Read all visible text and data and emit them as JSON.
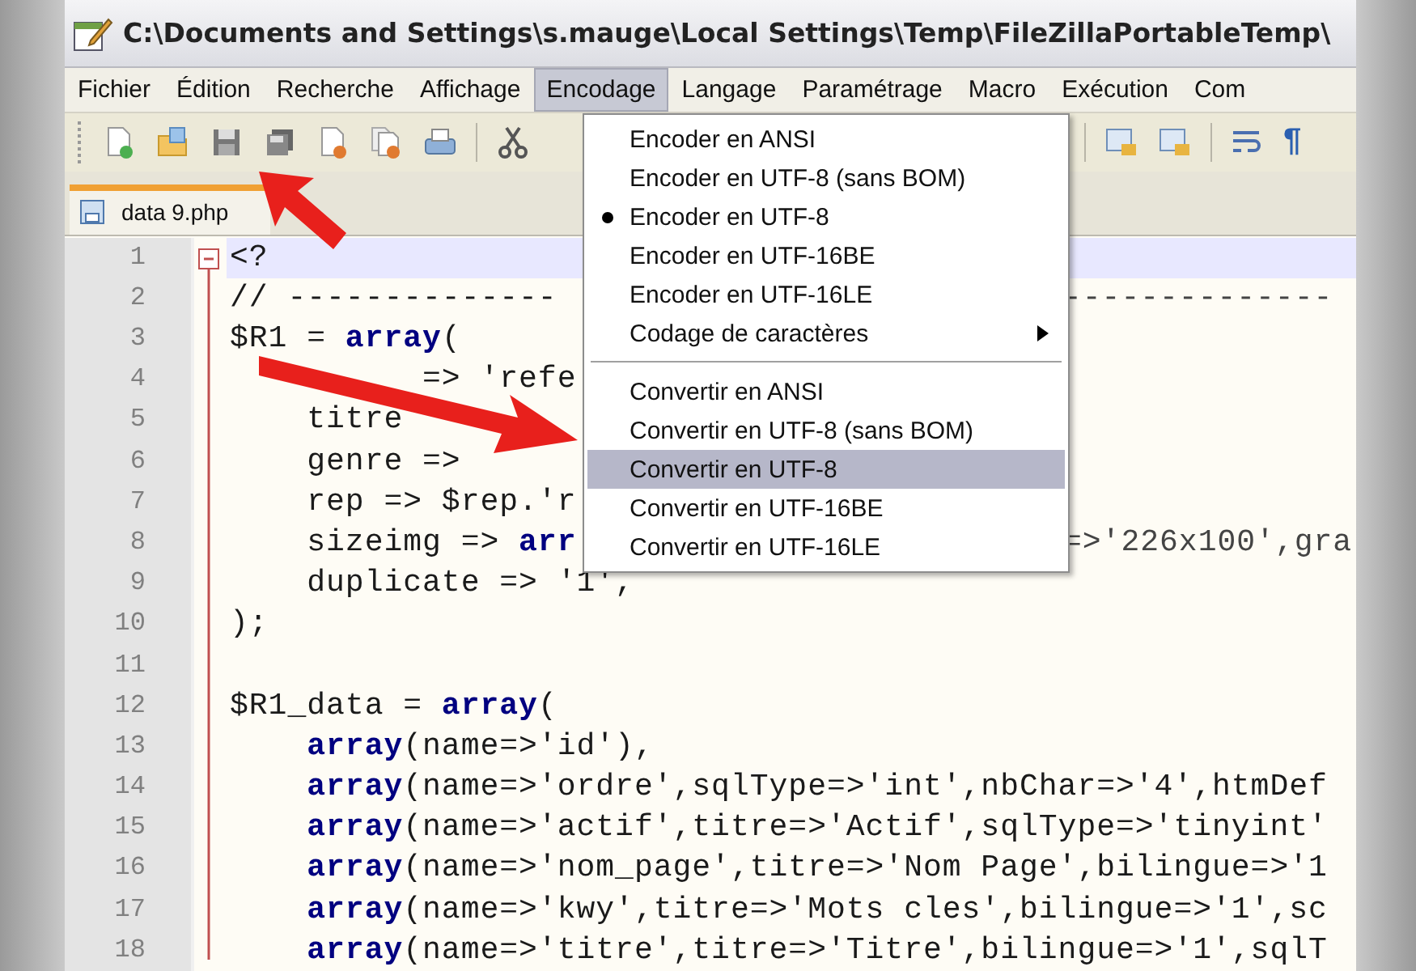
{
  "window": {
    "title": "C:\\Documents and Settings\\s.mauge\\Local Settings\\Temp\\FileZillaPortableTemp\\"
  },
  "menu_bar": [
    {
      "label": "Fichier",
      "selected": false
    },
    {
      "label": "Édition",
      "selected": false
    },
    {
      "label": "Recherche",
      "selected": false
    },
    {
      "label": "Affichage",
      "selected": false
    },
    {
      "label": "Encodage",
      "selected": true
    },
    {
      "label": "Langage",
      "selected": false
    },
    {
      "label": "Paramétrage",
      "selected": false
    },
    {
      "label": "Macro",
      "selected": false
    },
    {
      "label": "Exécution",
      "selected": false
    },
    {
      "label": "Com",
      "selected": false
    }
  ],
  "toolbar": {
    "pilcrow": "¶"
  },
  "tabs": [
    {
      "label": "data 9.php",
      "selected": true
    }
  ],
  "dropdown": [
    {
      "kind": "item",
      "label": "Encoder en ANSI",
      "checked": false,
      "selected": false
    },
    {
      "kind": "item",
      "label": "Encoder en UTF-8 (sans BOM)",
      "checked": false,
      "selected": false
    },
    {
      "kind": "item",
      "label": "Encoder en UTF-8",
      "checked": true,
      "selected": false
    },
    {
      "kind": "item",
      "label": "Encoder en UTF-16BE",
      "checked": false,
      "selected": false
    },
    {
      "kind": "item",
      "label": "Encoder en UTF-16LE",
      "checked": false,
      "selected": false
    },
    {
      "kind": "submenu",
      "label": "Codage de caractères",
      "checked": false,
      "selected": false
    },
    {
      "kind": "separator"
    },
    {
      "kind": "item",
      "label": "Convertir en ANSI",
      "checked": false,
      "selected": false
    },
    {
      "kind": "item",
      "label": "Convertir en UTF-8 (sans BOM)",
      "checked": false,
      "selected": false
    },
    {
      "kind": "item",
      "label": "Convertir en UTF-8",
      "checked": false,
      "selected": true
    },
    {
      "kind": "item",
      "label": "Convertir en UTF-16BE",
      "checked": false,
      "selected": false
    },
    {
      "kind": "item",
      "label": "Convertir en UTF-16LE",
      "checked": false,
      "selected": false
    }
  ],
  "editor": {
    "lines": [
      {
        "number": "1",
        "text": "<?",
        "current": true
      },
      {
        "number": "2",
        "text": "// --------------",
        "tail": "--------------",
        "current": false
      },
      {
        "number": "3",
        "text": "$R1 = **array**(",
        "current": false
      },
      {
        "number": "4",
        "text": "          => 'refe",
        "current": false
      },
      {
        "number": "5",
        "text": "    titre",
        "current": false
      },
      {
        "number": "6",
        "text": "    genre =>",
        "current": false
      },
      {
        "number": "7",
        "text": "    rep => $rep.'r",
        "current": false
      },
      {
        "number": "8",
        "text": "    sizeimg => **arr**",
        "tail": "=>'226x100',gra",
        "current": false
      },
      {
        "number": "9",
        "text": "    duplicate => '1',",
        "current": false
      },
      {
        "number": "10",
        "text": ");",
        "current": false
      },
      {
        "number": "11",
        "current": false
      },
      {
        "number": "12",
        "text": "$R1_data = **array**(",
        "current": false
      },
      {
        "number": "13",
        "text": "    **array**(name=>'id'),",
        "current": false
      },
      {
        "number": "14",
        "text": "    **array**(name=>'ordre',sqlType=>'int',nbChar=>'4',htmDef",
        "current": false
      },
      {
        "number": "15",
        "text": "    **array**(name=>'actif',titre=>'Actif',sqlType=>'tinyint'",
        "current": false
      },
      {
        "number": "16",
        "text": "    **array**(name=>'nom_page',titre=>'Nom Page',bilingue=>'1",
        "current": false
      },
      {
        "number": "17",
        "text": "    **array**(name=>'kwy',titre=>'Mots cles',bilingue=>'1',sc",
        "current": false
      },
      {
        "number": "18",
        "text": "    **array**(name=>'titre',titre=>'Titre',bilingue=>'1',sqlT",
        "current": false
      }
    ]
  }
}
